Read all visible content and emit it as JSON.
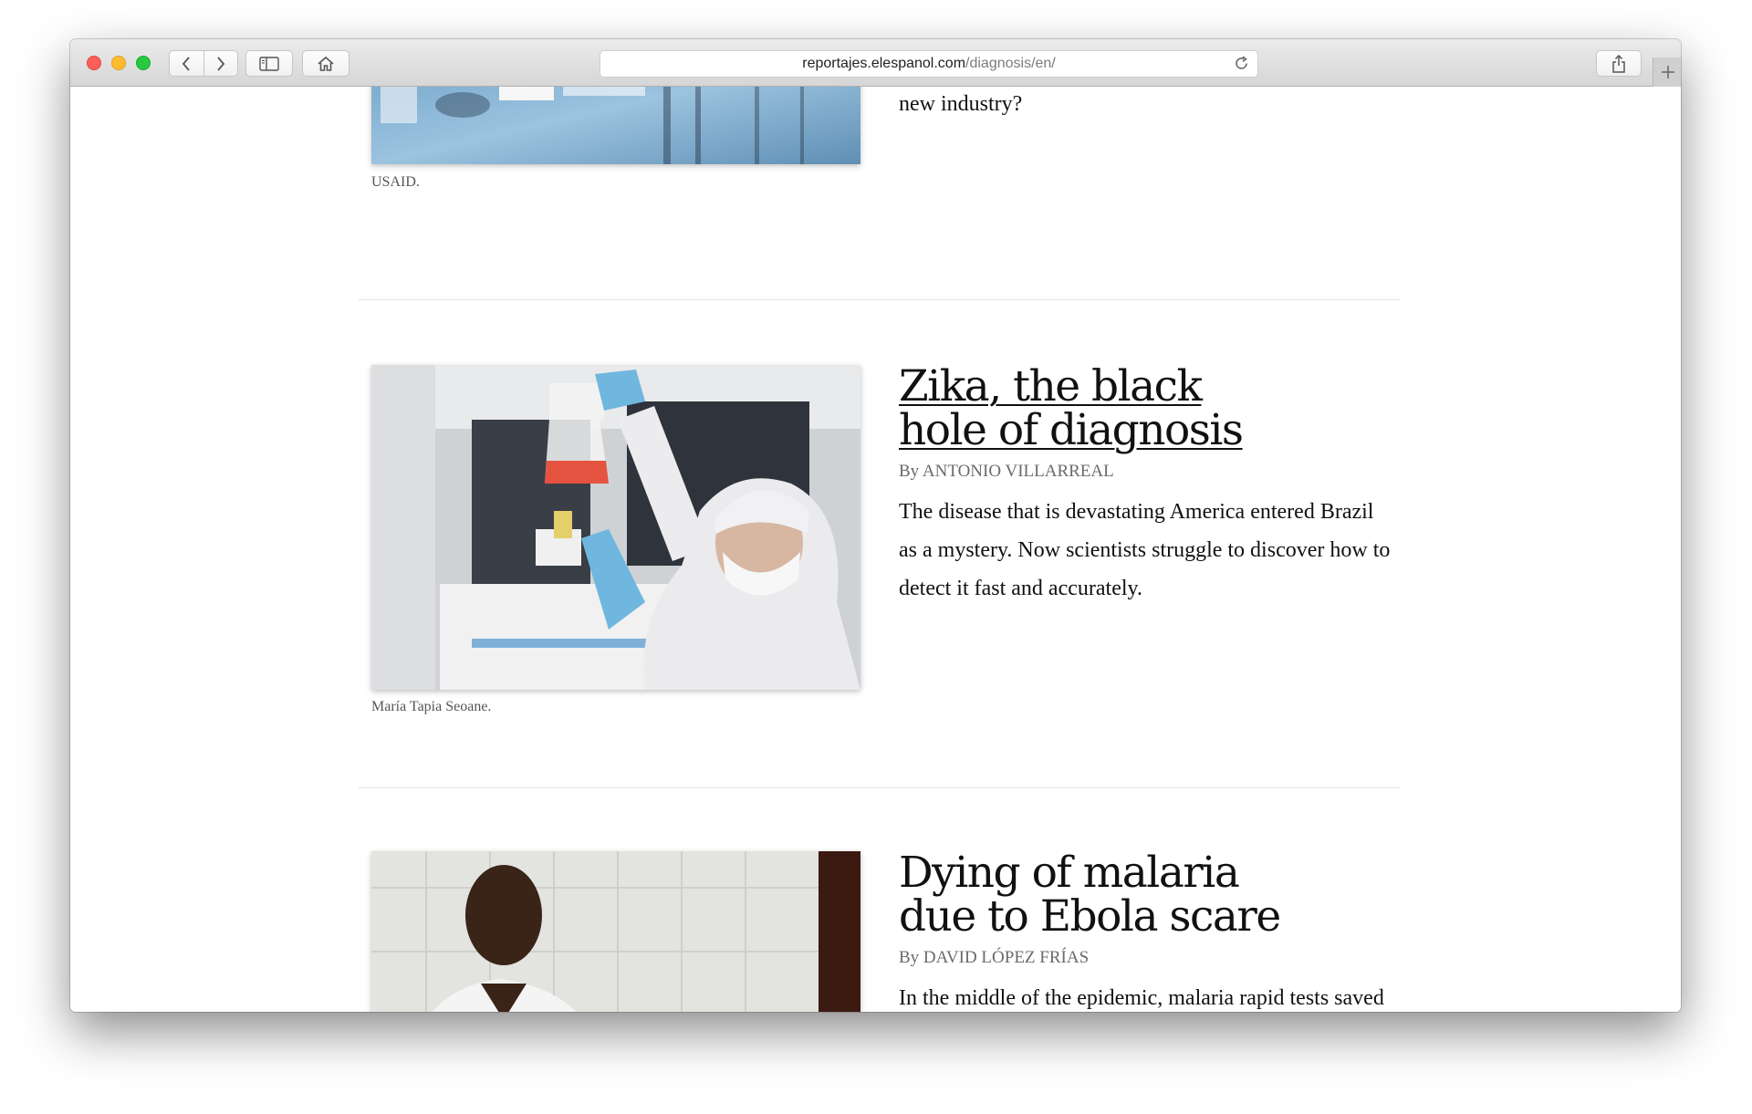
{
  "browser": {
    "url_domain": "reportajes.elespanol.com",
    "url_path": "/diagnosis/en/",
    "icons": {
      "back": "chevron-left-icon",
      "forward": "chevron-right-icon",
      "sidebar": "sidebar-icon",
      "home": "home-icon",
      "reload": "reload-icon",
      "share": "share-icon",
      "add_tab": "plus-icon"
    }
  },
  "articles": [
    {
      "summary_tail": "new industry?",
      "caption": "USAID."
    },
    {
      "title_line1": "Zika, the black",
      "title_line2": "hole of diagnosis",
      "byline": "By ANTONIO VILLARREAL",
      "summary": "The disease that is devastating America entered Brazil as a mystery. Now scientists struggle to discover how to detect it fast and accurately.",
      "caption": "María Tapia Seoane."
    },
    {
      "title_line1": "Dying of malaria",
      "title_line2": "due to Ebola scare",
      "byline": "By DAVID LÓPEZ FRÍAS",
      "summary": "In the middle of the epidemic, malaria rapid tests saved many Africans from death, but also"
    }
  ]
}
